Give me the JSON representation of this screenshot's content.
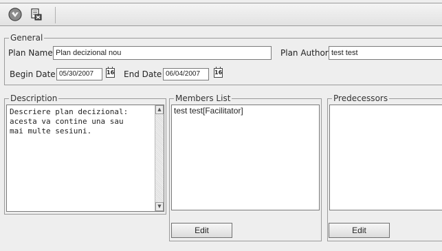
{
  "toolbar": {
    "buttons": [
      {
        "icon": "save-icon"
      },
      {
        "icon": "close-document-icon"
      }
    ]
  },
  "general": {
    "legend": "General",
    "plan_name_label": "Plan Name",
    "plan_name_value": "Plan decizional nou",
    "plan_author_label": "Plan Author",
    "plan_author_value": "test test",
    "begin_date_label": "Begin Date",
    "begin_date_value": "05/30/2007",
    "end_date_label": "End Date",
    "end_date_value": "06/04/2007",
    "calendar_icon_text": "16"
  },
  "description": {
    "legend": "Description",
    "text": "Descriere plan decizional:\nacesta va contine una sau\nmai multe sesiuni."
  },
  "members": {
    "legend": "Members List",
    "items": [
      "test test[Facilitator]"
    ],
    "edit_label": "Edit"
  },
  "predecessors": {
    "legend": "Predecessors",
    "items": [],
    "edit_label": "Edit"
  }
}
